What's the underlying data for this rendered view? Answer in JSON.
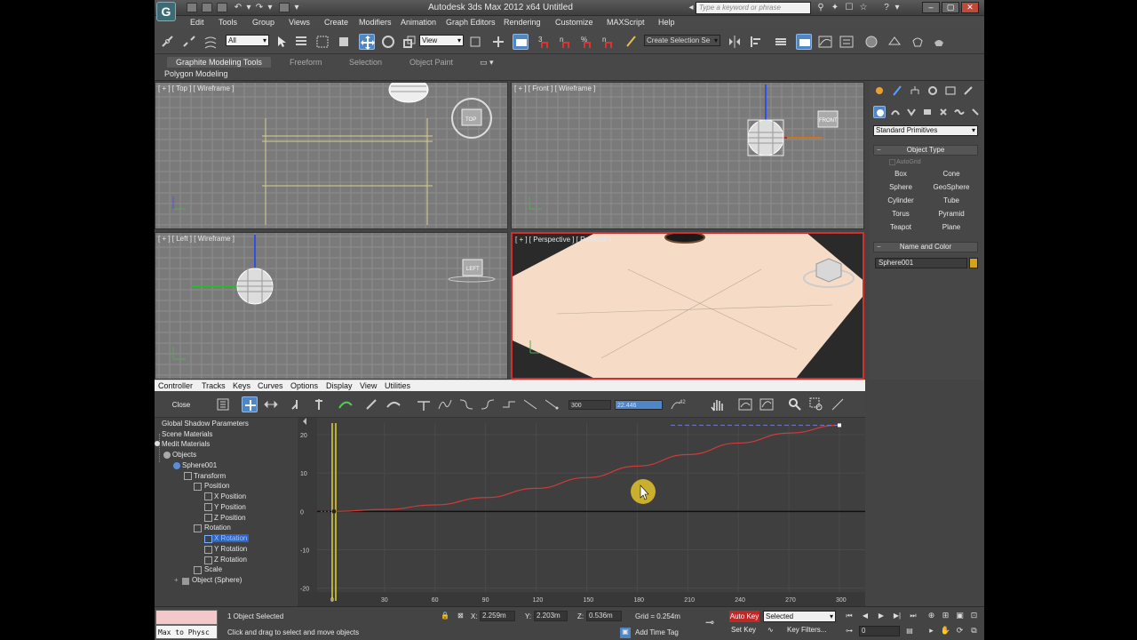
{
  "window": {
    "title": "Autodesk 3ds Max 2012 x64      Untitled",
    "logo_glyph": "G",
    "search_placeholder": "Type a keyword or phrase",
    "minimize": "–",
    "maximize": "▢",
    "close": "✕"
  },
  "menubar": [
    "Edit",
    "Tools",
    "Group",
    "Views",
    "Create",
    "Modifiers",
    "Animation",
    "Graph Editors",
    "Rendering",
    "Customize",
    "MAXScript",
    "Help"
  ],
  "main_toolbar": {
    "selection_filter": "All",
    "ref_coord": "View",
    "named_selection": "Create Selection Se",
    "snap_labels": [
      "3",
      "n",
      "%",
      "n"
    ]
  },
  "ribbon": {
    "tabs": [
      "Graphite Modeling Tools",
      "Freeform",
      "Selection",
      "Object Paint"
    ],
    "active_tab": "Graphite Modeling Tools",
    "sub_label": "Polygon Modeling"
  },
  "viewports": {
    "top": "[ + ] [ Top ] [ Wireframe ]",
    "front": "[ + ] [ Front ] [ Wireframe ]",
    "left": "[ + ] [ Left ] [ Wireframe ]",
    "perspective": "[ + ] [ Perspective ] [ Realistic ]",
    "cube_top": "TOP",
    "cube_front": "FRONT",
    "cube_left": "LEFT"
  },
  "command_panel": {
    "category": "Standard Primitives",
    "object_type_header": "Object Type",
    "autogrid": "AutoGrid",
    "primitives": [
      "Box",
      "Cone",
      "Sphere",
      "GeoSphere",
      "Cylinder",
      "Tube",
      "Torus",
      "Pyramid",
      "Teapot",
      "Plane"
    ],
    "name_color_header": "Name and Color",
    "object_name": "Sphere001",
    "object_color": "#d4a418"
  },
  "curve_editor": {
    "menu": [
      "Controller",
      "Tracks",
      "Keys",
      "Curves",
      "Options",
      "Display",
      "View",
      "Utilities"
    ],
    "close_label": "Close",
    "frame_field": "300",
    "value_field": "22.446",
    "tree": [
      {
        "label": "Global Shadow Parameters"
      },
      {
        "label": "Scene Materials"
      },
      {
        "label": "Medit Materials"
      },
      {
        "label": "Objects"
      },
      {
        "label": "Sphere001"
      },
      {
        "label": "Transform"
      },
      {
        "label": "Position"
      },
      {
        "label": "X Position"
      },
      {
        "label": "Y Position"
      },
      {
        "label": "Z Position"
      },
      {
        "label": "Rotation"
      },
      {
        "label": "X Rotation"
      },
      {
        "label": "Y Rotation"
      },
      {
        "label": "Z Rotation"
      },
      {
        "label": "Scale"
      },
      {
        "label": "Object (Sphere)"
      }
    ],
    "selected_track": "X Rotation"
  },
  "chart_data": {
    "type": "line",
    "xlim": [
      -10,
      300
    ],
    "ylim": [
      -21,
      23
    ],
    "x_ticks": [
      0,
      30,
      60,
      90,
      120,
      150,
      180,
      210,
      240,
      270,
      300
    ],
    "y_ticks": [
      20,
      10,
      0,
      -10,
      -20
    ],
    "x_tick_labels": [
      "0",
      "30",
      "60",
      "90",
      "120",
      "150",
      "180",
      "210",
      "240",
      "270",
      "300"
    ],
    "y_tick_labels": [
      "20",
      "10",
      "0",
      "-10",
      "-20"
    ],
    "current_frame": 0,
    "series": [
      {
        "color": "#d03a3a",
        "x": [
          0,
          30,
          60,
          90,
          120,
          150,
          180,
          210,
          240,
          270,
          300
        ],
        "y": [
          0,
          0.5,
          1.7,
          3.6,
          6.0,
          8.8,
          11.8,
          14.8,
          17.8,
          20.4,
          22.446
        ]
      }
    ],
    "key_value": 22.446,
    "key_frame": 300
  },
  "statusbar": {
    "maxscript": "Max to Physc",
    "selection_status": "1 Object Selected",
    "prompt": "Click and drag to select and move objects",
    "x_label": "X:",
    "x_value": "2.259m",
    "y_label": "Y:",
    "y_value": "2.203m",
    "z_label": "Z:",
    "z_value": "0.536m",
    "grid": "Grid = 0.254m",
    "add_time_tag": "Add Time Tag",
    "autokey": "Auto Key",
    "setkey": "Set Key",
    "selected": "Selected",
    "key_filters": "Key Filters...",
    "frame": "0"
  }
}
